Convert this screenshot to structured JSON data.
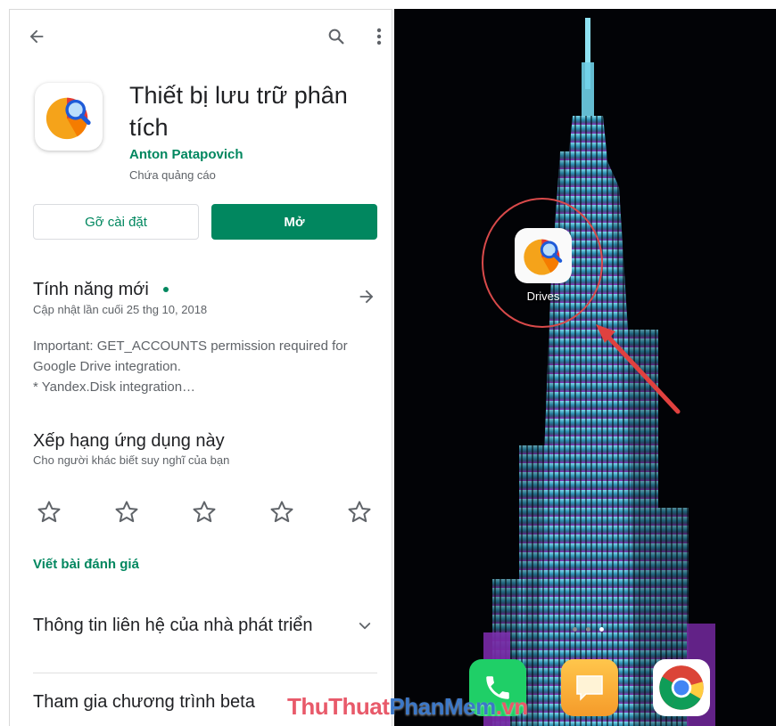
{
  "store": {
    "app_title": "Thiết bị lưu trữ phân tích",
    "developer": "Anton Patapovich",
    "ads_note": "Chứa quảng cáo",
    "uninstall_label": "Gỡ cài đặt",
    "open_label": "Mở",
    "whats_new": {
      "title": "Tính năng mới",
      "updated": "Cập nhật lần cuối 25 thg 10, 2018",
      "notes": [
        "Important: GET_ACCOUNTS permission required for",
        "Google Drive integration.",
        "* Yandex.Disk integration…"
      ]
    },
    "rate": {
      "title": "Xếp hạng ứng dụng này",
      "subtitle": "Cho người khác biết suy nghĩ của bạn",
      "stars": 5
    },
    "write_review": "Viết bài đánh giá",
    "contact_title": "Thông tin liên hệ của nhà phát triển",
    "beta_title": "Tham gia chương trình beta"
  },
  "home": {
    "app_label": "Drives",
    "dock": [
      "phone-icon",
      "messages-icon",
      "chrome-icon"
    ],
    "page_dots": 3,
    "active_page": 3
  },
  "watermark": {
    "part1": "ThuThuat",
    "part2": "PhanMem",
    "part3": ".vn"
  },
  "colors": {
    "accent_green": "#01875f",
    "highlight_red": "#d94a4a"
  }
}
